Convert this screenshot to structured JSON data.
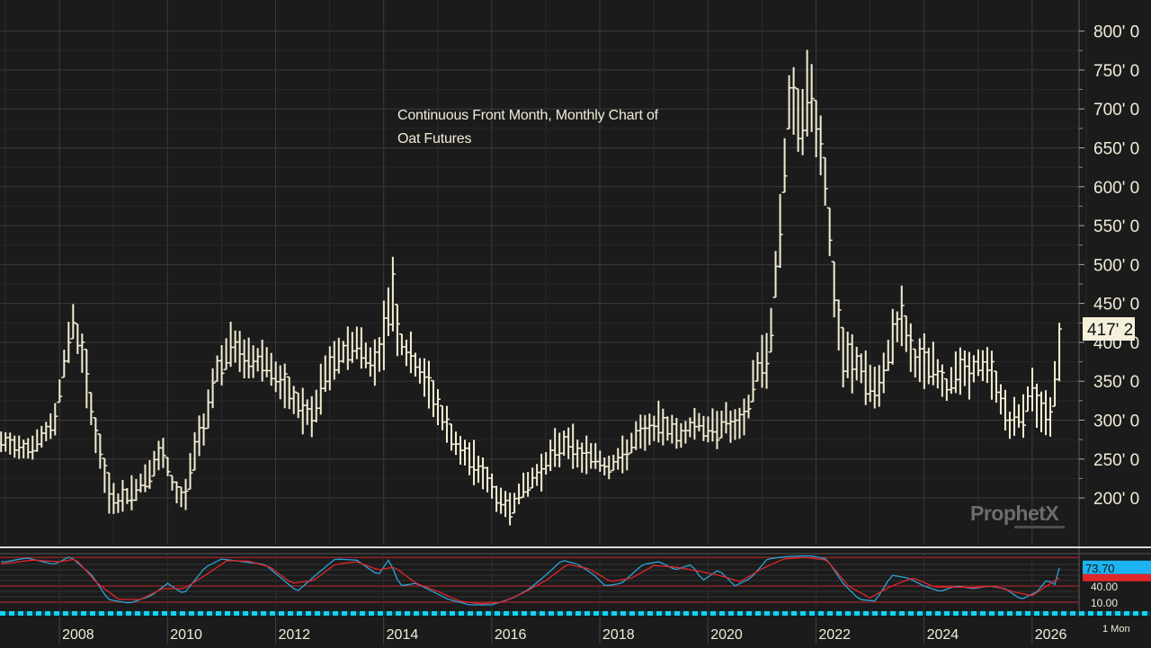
{
  "title": {
    "line1": "Continuous Front Month, Monthly Chart of",
    "line2": "Oat Futures"
  },
  "brand": "ProphetX",
  "last_price_label": "417' 2",
  "period_label": "1 Mon",
  "colors": {
    "background": "#1b1b1b",
    "bars": "#f3eed3",
    "grid": "#3a3a3a",
    "axis_text": "#f0ecd8",
    "stoch_k": "#2aa3d8",
    "stoch_d": "#e0262a",
    "stoch_level": "#c0282c",
    "current_k_badge": "#1cb4f0",
    "bottom_strip": "#15d2ee"
  },
  "chart_data": [
    {
      "type": "bar",
      "subtype": "ohlc",
      "y_tick_labels": [
        "200' 0",
        "250' 0",
        "300' 0",
        "350' 0",
        "400' 0",
        "450' 0",
        "500' 0",
        "550' 0",
        "600' 0",
        "650' 0",
        "700' 0",
        "750' 0",
        "800' 0"
      ],
      "y_ticks": [
        200,
        250,
        300,
        350,
        400,
        450,
        500,
        550,
        600,
        650,
        700,
        750,
        800
      ],
      "ylim": [
        140,
        840
      ],
      "x_tick_labels": [
        "2008",
        "2010",
        "2012",
        "2014",
        "2016",
        "2018",
        "2020",
        "2022",
        "2024",
        "2026"
      ],
      "x_ticks": [
        2008,
        2010,
        2012,
        2014,
        2016,
        2018,
        2020,
        2022,
        2024,
        2026
      ],
      "xlim": [
        2006.9,
        2028.2
      ],
      "last_price": 417.25,
      "grid": true,
      "anchors": [
        [
          2007.0,
          270,
          25
        ],
        [
          2007.5,
          265,
          25
        ],
        [
          2007.9,
          295,
          30
        ],
        [
          2008.1,
          380,
          40
        ],
        [
          2008.25,
          425,
          35
        ],
        [
          2008.4,
          395,
          40
        ],
        [
          2008.7,
          270,
          45
        ],
        [
          2008.9,
          205,
          40
        ],
        [
          2009.1,
          195,
          30
        ],
        [
          2009.4,
          210,
          30
        ],
        [
          2009.7,
          235,
          35
        ],
        [
          2009.9,
          260,
          30
        ],
        [
          2010.1,
          215,
          25
        ],
        [
          2010.3,
          195,
          25
        ],
        [
          2010.5,
          260,
          35
        ],
        [
          2010.7,
          300,
          35
        ],
        [
          2010.9,
          365,
          40
        ],
        [
          2011.2,
          395,
          45
        ],
        [
          2011.5,
          375,
          40
        ],
        [
          2011.8,
          380,
          40
        ],
        [
          2012.1,
          345,
          35
        ],
        [
          2012.4,
          320,
          35
        ],
        [
          2012.7,
          300,
          35
        ],
        [
          2012.9,
          355,
          45
        ],
        [
          2013.2,
          385,
          35
        ],
        [
          2013.5,
          400,
          40
        ],
        [
          2013.8,
          370,
          40
        ],
        [
          2014.0,
          405,
          55
        ],
        [
          2014.15,
          470,
          90
        ],
        [
          2014.3,
          400,
          40
        ],
        [
          2014.6,
          370,
          45
        ],
        [
          2014.9,
          335,
          40
        ],
        [
          2015.1,
          300,
          35
        ],
        [
          2015.4,
          260,
          35
        ],
        [
          2015.7,
          245,
          30
        ],
        [
          2015.9,
          225,
          30
        ],
        [
          2016.1,
          200,
          35
        ],
        [
          2016.3,
          185,
          30
        ],
        [
          2016.5,
          205,
          30
        ],
        [
          2016.7,
          220,
          30
        ],
        [
          2016.9,
          235,
          30
        ],
        [
          2017.1,
          255,
          30
        ],
        [
          2017.4,
          275,
          35
        ],
        [
          2017.6,
          255,
          30
        ],
        [
          2017.9,
          255,
          30
        ],
        [
          2018.1,
          240,
          30
        ],
        [
          2018.4,
          250,
          30
        ],
        [
          2018.7,
          280,
          30
        ],
        [
          2019.0,
          290,
          30
        ],
        [
          2019.2,
          295,
          35
        ],
        [
          2019.5,
          280,
          30
        ],
        [
          2019.8,
          300,
          30
        ],
        [
          2020.0,
          285,
          30
        ],
        [
          2020.3,
          300,
          35
        ],
        [
          2020.5,
          290,
          30
        ],
        [
          2020.7,
          300,
          35
        ],
        [
          2020.9,
          370,
          40
        ],
        [
          2021.1,
          380,
          45
        ],
        [
          2021.2,
          440,
          45
        ],
        [
          2021.35,
          560,
          60
        ],
        [
          2021.5,
          710,
          60
        ],
        [
          2021.7,
          680,
          70
        ],
        [
          2021.9,
          720,
          80
        ],
        [
          2022.1,
          650,
          70
        ],
        [
          2022.2,
          590,
          70
        ],
        [
          2022.35,
          450,
          60
        ],
        [
          2022.5,
          380,
          50
        ],
        [
          2022.8,
          370,
          45
        ],
        [
          2023.0,
          345,
          45
        ],
        [
          2023.2,
          335,
          40
        ],
        [
          2023.4,
          410,
          45
        ],
        [
          2023.6,
          430,
          50
        ],
        [
          2023.8,
          375,
          45
        ],
        [
          2024.0,
          375,
          40
        ],
        [
          2024.2,
          370,
          40
        ],
        [
          2024.4,
          335,
          40
        ],
        [
          2024.6,
          370,
          40
        ],
        [
          2024.8,
          360,
          35
        ],
        [
          2025.0,
          370,
          35
        ],
        [
          2025.2,
          370,
          35
        ],
        [
          2025.4,
          330,
          40
        ],
        [
          2025.6,
          295,
          35
        ],
        [
          2025.8,
          305,
          35
        ],
        [
          2026.0,
          340,
          45
        ],
        [
          2026.2,
          300,
          40
        ],
        [
          2026.35,
          310,
          40
        ],
        [
          2026.5,
          400,
          50
        ]
      ]
    },
    {
      "type": "line",
      "name": "",
      "y_tick_labels": [
        "40.00",
        "10.00"
      ],
      "levels": [
        40,
        10
      ],
      "ylim": [
        0,
        100
      ],
      "current_k_label": "73.70",
      "series": [
        {
          "name": "",
          "color": "#2aa3d8",
          "anchors": [
            [
              2007.0,
              85
            ],
            [
              2007.4,
              92
            ],
            [
              2007.9,
              80
            ],
            [
              2008.2,
              95
            ],
            [
              2008.6,
              60
            ],
            [
              2008.9,
              15
            ],
            [
              2009.3,
              8
            ],
            [
              2009.7,
              22
            ],
            [
              2010.0,
              45
            ],
            [
              2010.3,
              25
            ],
            [
              2010.7,
              75
            ],
            [
              2011.0,
              90
            ],
            [
              2011.4,
              85
            ],
            [
              2011.8,
              80
            ],
            [
              2012.1,
              55
            ],
            [
              2012.4,
              30
            ],
            [
              2012.8,
              65
            ],
            [
              2013.1,
              90
            ],
            [
              2013.5,
              88
            ],
            [
              2013.9,
              60
            ],
            [
              2014.1,
              90
            ],
            [
              2014.3,
              40
            ],
            [
              2014.6,
              45
            ],
            [
              2014.9,
              30
            ],
            [
              2015.2,
              15
            ],
            [
              2015.6,
              5
            ],
            [
              2016.0,
              5
            ],
            [
              2016.4,
              18
            ],
            [
              2016.7,
              35
            ],
            [
              2017.0,
              60
            ],
            [
              2017.3,
              88
            ],
            [
              2017.6,
              80
            ],
            [
              2017.9,
              60
            ],
            [
              2018.1,
              40
            ],
            [
              2018.4,
              45
            ],
            [
              2018.8,
              80
            ],
            [
              2019.1,
              85
            ],
            [
              2019.4,
              70
            ],
            [
              2019.7,
              80
            ],
            [
              2019.9,
              50
            ],
            [
              2020.2,
              70
            ],
            [
              2020.5,
              40
            ],
            [
              2020.8,
              55
            ],
            [
              2021.1,
              90
            ],
            [
              2021.5,
              95
            ],
            [
              2021.9,
              96
            ],
            [
              2022.2,
              90
            ],
            [
              2022.5,
              45
            ],
            [
              2022.8,
              15
            ],
            [
              2023.1,
              12
            ],
            [
              2023.4,
              60
            ],
            [
              2023.7,
              55
            ],
            [
              2024.0,
              40
            ],
            [
              2024.3,
              30
            ],
            [
              2024.6,
              40
            ],
            [
              2024.9,
              35
            ],
            [
              2025.2,
              40
            ],
            [
              2025.5,
              35
            ],
            [
              2025.8,
              15
            ],
            [
              2026.1,
              30
            ],
            [
              2026.3,
              55
            ],
            [
              2026.4,
              35
            ],
            [
              2026.5,
              73.7
            ]
          ]
        },
        {
          "name": "",
          "color": "#e0262a",
          "anchors": [
            [
              2007.0,
              82
            ],
            [
              2007.5,
              88
            ],
            [
              2008.0,
              85
            ],
            [
              2008.3,
              90
            ],
            [
              2008.7,
              45
            ],
            [
              2009.1,
              15
            ],
            [
              2009.5,
              15
            ],
            [
              2009.9,
              35
            ],
            [
              2010.3,
              35
            ],
            [
              2010.7,
              60
            ],
            [
              2011.1,
              87
            ],
            [
              2011.5,
              86
            ],
            [
              2011.9,
              75
            ],
            [
              2012.3,
              45
            ],
            [
              2012.7,
              50
            ],
            [
              2013.1,
              80
            ],
            [
              2013.5,
              85
            ],
            [
              2013.9,
              70
            ],
            [
              2014.2,
              75
            ],
            [
              2014.6,
              45
            ],
            [
              2015.0,
              30
            ],
            [
              2015.4,
              12
            ],
            [
              2015.8,
              7
            ],
            [
              2016.2,
              10
            ],
            [
              2016.6,
              28
            ],
            [
              2017.0,
              50
            ],
            [
              2017.4,
              80
            ],
            [
              2017.8,
              72
            ],
            [
              2018.2,
              48
            ],
            [
              2018.6,
              55
            ],
            [
              2019.0,
              78
            ],
            [
              2019.4,
              75
            ],
            [
              2019.8,
              68
            ],
            [
              2020.2,
              60
            ],
            [
              2020.6,
              48
            ],
            [
              2021.0,
              72
            ],
            [
              2021.4,
              90
            ],
            [
              2021.8,
              93
            ],
            [
              2022.2,
              88
            ],
            [
              2022.6,
              40
            ],
            [
              2023.0,
              18
            ],
            [
              2023.4,
              40
            ],
            [
              2023.8,
              55
            ],
            [
              2024.2,
              38
            ],
            [
              2024.6,
              38
            ],
            [
              2024.9,
              37
            ],
            [
              2025.3,
              40
            ],
            [
              2025.7,
              28
            ],
            [
              2026.0,
              22
            ],
            [
              2026.3,
              42
            ],
            [
              2026.5,
              55
            ]
          ]
        }
      ]
    }
  ]
}
